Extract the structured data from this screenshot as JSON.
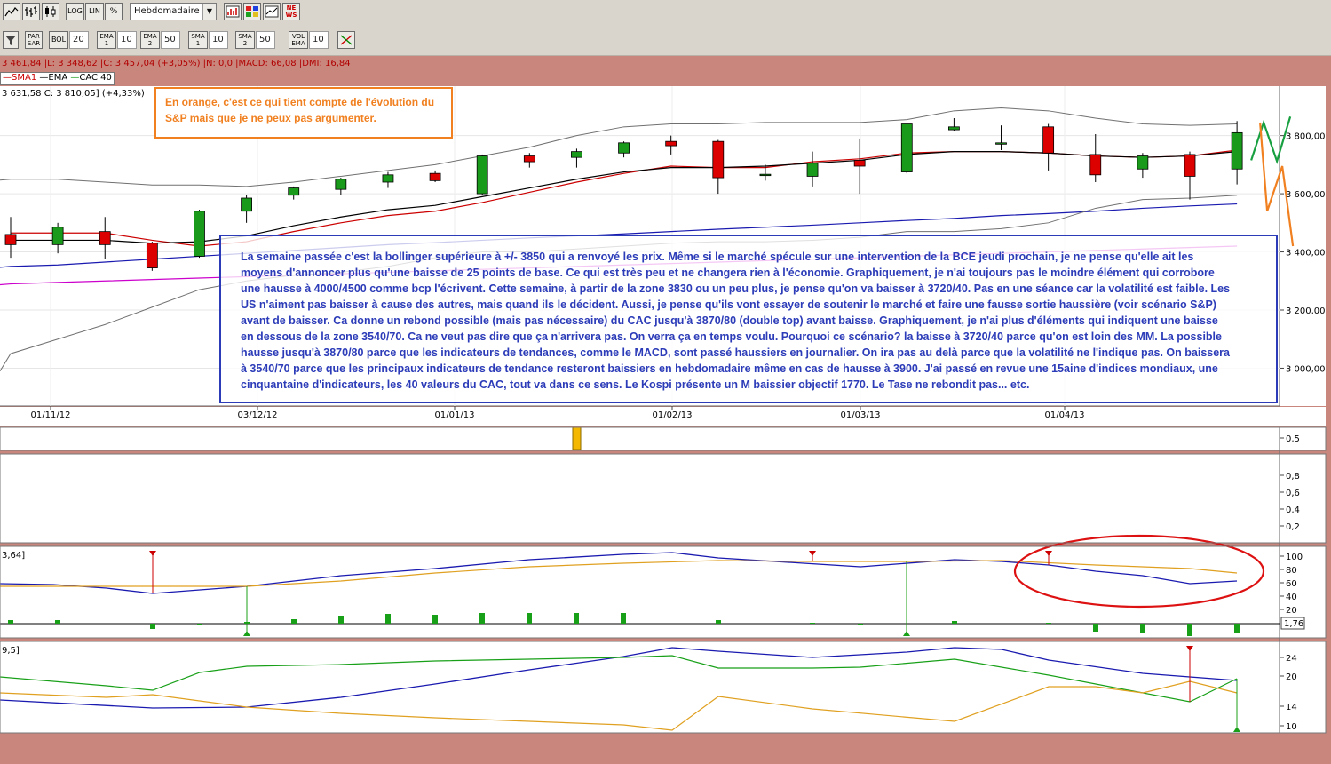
{
  "toolbar1": {
    "scale_log": "LOG",
    "scale_lin": "LIN",
    "scale_pct": "%",
    "period": "Hebdomadaire",
    "news_label": "NE WS"
  },
  "toolbar2": {
    "par_sar": "PAR SAR",
    "bol": "BOL",
    "bol_value": "20",
    "ema1": "EMA 1",
    "ema1_value": "10",
    "ema2": "EMA 2",
    "ema2_value": "50",
    "sma1": "SMA 1",
    "sma1_value": "10",
    "sma2": "SMA 2",
    "sma2_value": "50",
    "vol_ema": "VOL EMA",
    "vol_ema_value": "10"
  },
  "info_line": "3 461,84 |L: 3 348,62 |C: 3 457,04 (+3,05%) |N: 0,0 |MACD: 66,08 |DMI: 16,84",
  "legend": {
    "sma1": "SMA1",
    "ema": "EMA",
    "cac": "CAC 40"
  },
  "price_line": "3 631,58  C: 3 810,05] (+4,33%)",
  "annotation_orange": "En orange, c'est ce qui tient compte de l'évolution du S&P mais que je ne peux pas argumenter.",
  "annotation_blue": "La semaine passée c'est la bollinger supérieure à +/- 3850 qui a renvoyé les prix. Même si le marché spécule sur une intervention de la BCE jeudi prochain, je ne pense qu'elle ait les moyens d'annoncer plus qu'une baisse de 25 points de base. Ce qui est très peu et ne changera rien à l'économie. Graphiquement, je n'ai toujours pas le moindre élément qui corrobore une hausse à 4000/4500 comme bcp l'écrivent. Cette semaine, à partir de la zone 3830 ou un peu plus, je pense qu'on va baisser à 3720/40. Pas en une séance car la volatilité est faible. Les US n'aiment pas baisser à cause des autres, mais quand ils le décident. Aussi, je pense qu'ils vont essayer de soutenir le marché et faire une fausse sortie haussière (voir scénario S&P) avant de baisser. Ca donne un rebond possible (mais pas nécessaire) du CAC jusqu'à 3870/80 (double top) avant baisse. Graphiquement, je n'ai plus d'éléments qui indiquent une baisse en dessous de la zone 3540/70. Ca ne veut pas dire que ça n'arrivera pas. On verra ça en temps voulu. Pourquoi ce scénario? la baisse à 3720/40 parce qu'on est loin des MM. La possible hausse jusqu'à 3870/80 parce que les indicateurs de tendances, comme le MACD, sont passé haussiers en journalier. On ira pas au delà parce que la volatilité ne l'indique pas. On baissera à 3540/70 parce que les principaux indicateurs de tendance resteront baissiers en hebdomadaire même en cas de hausse à 3900. J'ai passé en revue une 15aine d'indices mondiaux, une cinquantaine d'indicateurs, les 40 valeurs du CAC, tout va dans ce sens. Le Kospi présente un M baissier objectif 1770. Le Tase ne rebondit pas... etc.",
  "annotation_blue_lines": [
    "La semaine passée c'est la bollinger supérieure à +/- 3850 qui a renvoyé les prix. Même si le marché spécule sur une intervention de la BCE jeudi prochain, je ne pense qu'elle ait les",
    "moyens d'annoncer plus qu'une baisse de 25 points de base. Ce qui est très peu et ne changera rien à l'économie. Graphiquement, je n'ai toujours pas le moindre élément qui corrobore",
    "une hausse à 4000/4500 comme bcp l'écrivent. Cette semaine, à partir de la zone 3830 ou un peu plus, je pense qu'on va baisser à 3720/40. Pas en une séance car la volatilité est faible. Les",
    "US n'aiment pas baisser à cause des autres, mais quand ils le décident. Aussi, je pense qu'ils vont essayer de soutenir le marché et faire une fausse sortie haussière (voir scénario S&P)",
    "avant de baisser. Ca donne un rebond possible (mais pas nécessaire) du CAC jusqu'à 3870/80 (double top) avant baisse. Graphiquement, je n'ai plus d'éléments qui indiquent une baisse",
    "en dessous de la zone 3540/70. Ca ne veut pas dire que ça n'arrivera pas. On verra ça en temps voulu. Pourquoi ce scénario? la baisse à 3720/40 parce qu'on est loin des MM. La possible",
    "hausse jusqu'à 3870/80 parce que les indicateurs de tendances, comme le MACD, sont passé haussiers en journalier. On ira pas au delà parce que la volatilité ne l'indique pas. On baissera",
    "à 3540/70 parce que les principaux indicateurs de tendance resteront baissiers en hebdomadaire même en cas de hausse à 3900. J'ai passé en revue une 15aine d'indices mondiaux, une",
    "cinquantaine d'indicateurs, les 40 valeurs du CAC, tout va dans ce sens. Le Kospi présente un M baissier objectif 1770. Le Tase ne rebondit pas... etc."
  ],
  "axis_labels": {
    "price": [
      "3 800,00",
      "3 600,00",
      "3 400,00",
      "3 200,00",
      "3 000,00"
    ],
    "dates": [
      "01/11/12",
      "03/12/12",
      "01/01/13",
      "01/02/13",
      "01/03/13",
      "01/04/13"
    ],
    "volume": [
      "0,5"
    ],
    "panel3": [
      "0,8",
      "0,6",
      "0,4",
      "0,2"
    ],
    "stoch": [
      "100",
      "80",
      "60",
      "40",
      "20"
    ],
    "stoch_value": "1,76",
    "dmi": [
      "24",
      "20",
      "14",
      "10"
    ]
  },
  "panel_labels": {
    "stoch": "3,64]",
    "dmi": "9,5]"
  },
  "colors": {
    "bull": "#1a9a1a",
    "bear": "#dd0000",
    "sma": "#cc0000",
    "ema": "#000000",
    "bollinger": "#707070",
    "ma_blue": "#1a1ab0",
    "ma_magenta": "#cc00cc",
    "orange": "#f08020",
    "blue_box": "#2c3cb8",
    "bg": "#c9867d"
  },
  "chart_data": {
    "type": "candlestick",
    "title": "CAC 40",
    "period": "Hebdomadaire",
    "ylim": [
      2870,
      3970
    ],
    "candles": [
      {
        "o": 3460,
        "h": 3520,
        "l": 3380,
        "c": 3425
      },
      {
        "o": 3425,
        "h": 3500,
        "l": 3395,
        "c": 3485
      },
      {
        "o": 3470,
        "h": 3520,
        "l": 3375,
        "c": 3425
      },
      {
        "o": 3430,
        "h": 3435,
        "l": 3335,
        "c": 3345
      },
      {
        "o": 3385,
        "h": 3545,
        "l": 3380,
        "c": 3540
      },
      {
        "o": 3540,
        "h": 3595,
        "l": 3500,
        "c": 3585
      },
      {
        "o": 3595,
        "h": 3625,
        "l": 3580,
        "c": 3620
      },
      {
        "o": 3615,
        "h": 3655,
        "l": 3595,
        "c": 3650
      },
      {
        "o": 3640,
        "h": 3675,
        "l": 3620,
        "c": 3665
      },
      {
        "o": 3670,
        "h": 3680,
        "l": 3640,
        "c": 3645
      },
      {
        "o": 3600,
        "h": 3735,
        "l": 3595,
        "c": 3730
      },
      {
        "o": 3730,
        "h": 3740,
        "l": 3690,
        "c": 3710
      },
      {
        "o": 3725,
        "h": 3755,
        "l": 3690,
        "c": 3745
      },
      {
        "o": 3740,
        "h": 3780,
        "l": 3725,
        "c": 3775
      },
      {
        "o": 3780,
        "h": 3800,
        "l": 3735,
        "c": 3765
      },
      {
        "o": 3780,
        "h": 3785,
        "l": 3600,
        "c": 3655
      },
      {
        "o": 3665,
        "h": 3700,
        "l": 3645,
        "c": 3667
      },
      {
        "o": 3660,
        "h": 3745,
        "l": 3625,
        "c": 3705
      },
      {
        "o": 3715,
        "h": 3790,
        "l": 3600,
        "c": 3695
      },
      {
        "o": 3675,
        "h": 3840,
        "l": 3670,
        "c": 3840
      },
      {
        "o": 3820,
        "h": 3860,
        "l": 3815,
        "c": 3830
      },
      {
        "o": 3775,
        "h": 3835,
        "l": 3750,
        "c": 3775
      },
      {
        "o": 3830,
        "h": 3840,
        "l": 3680,
        "c": 3740
      },
      {
        "o": 3735,
        "h": 3805,
        "l": 3640,
        "c": 3665
      },
      {
        "o": 3685,
        "h": 3740,
        "l": 3655,
        "c": 3730
      },
      {
        "o": 3735,
        "h": 3745,
        "l": 3580,
        "c": 3660
      },
      {
        "o": 3685,
        "h": 3850,
        "l": 3632,
        "c": 3810
      }
    ],
    "sma1": [
      3465,
      3465,
      3465,
      3440,
      3420,
      3435,
      3470,
      3500,
      3525,
      3540,
      3570,
      3605,
      3640,
      3670,
      3695,
      3690,
      3690,
      3710,
      3720,
      3740,
      3745,
      3745,
      3740,
      3730,
      3725,
      3730,
      3750
    ],
    "ema": [
      3440,
      3440,
      3440,
      3430,
      3435,
      3455,
      3490,
      3520,
      3545,
      3560,
      3590,
      3620,
      3650,
      3675,
      3690,
      3690,
      3695,
      3705,
      3715,
      3735,
      3745,
      3745,
      3740,
      3730,
      3725,
      3730,
      3745
    ],
    "bollinger_upper": [
      3650,
      3650,
      3640,
      3630,
      3630,
      3625,
      3640,
      3660,
      3680,
      3700,
      3730,
      3760,
      3800,
      3830,
      3840,
      3840,
      3845,
      3845,
      3845,
      3855,
      3885,
      3895,
      3885,
      3860,
      3840,
      3835,
      3840
    ],
    "bollinger_lower": [
      3050,
      3100,
      3150,
      3210,
      3270,
      3300,
      3320,
      3330,
      3350,
      3380,
      3400,
      3400,
      3410,
      3420,
      3430,
      3435,
      3435,
      3440,
      3450,
      3470,
      3470,
      3480,
      3500,
      3550,
      3580,
      3585,
      3595
    ],
    "ma_blue": [
      3350,
      3355,
      3365,
      3375,
      3385,
      3395,
      3405,
      3415,
      3425,
      3432,
      3440,
      3448,
      3455,
      3462,
      3470,
      3478,
      3485,
      3492,
      3500,
      3508,
      3515,
      3525,
      3532,
      3540,
      3550,
      3558,
      3565
    ],
    "ma_magenta": [
      3290,
      3295,
      3300,
      3305,
      3310,
      3315,
      3320,
      3325,
      3330,
      3335,
      3340,
      3345,
      3350,
      3355,
      3360,
      3365,
      3370,
      3375,
      3380,
      3385,
      3390,
      3395,
      3400,
      3405,
      3410,
      3415,
      3420
    ],
    "scenario_green": [
      3715,
      3845,
      3712,
      3865
    ],
    "scenario_orange": [
      3845,
      3540,
      3695,
      3420
    ]
  }
}
